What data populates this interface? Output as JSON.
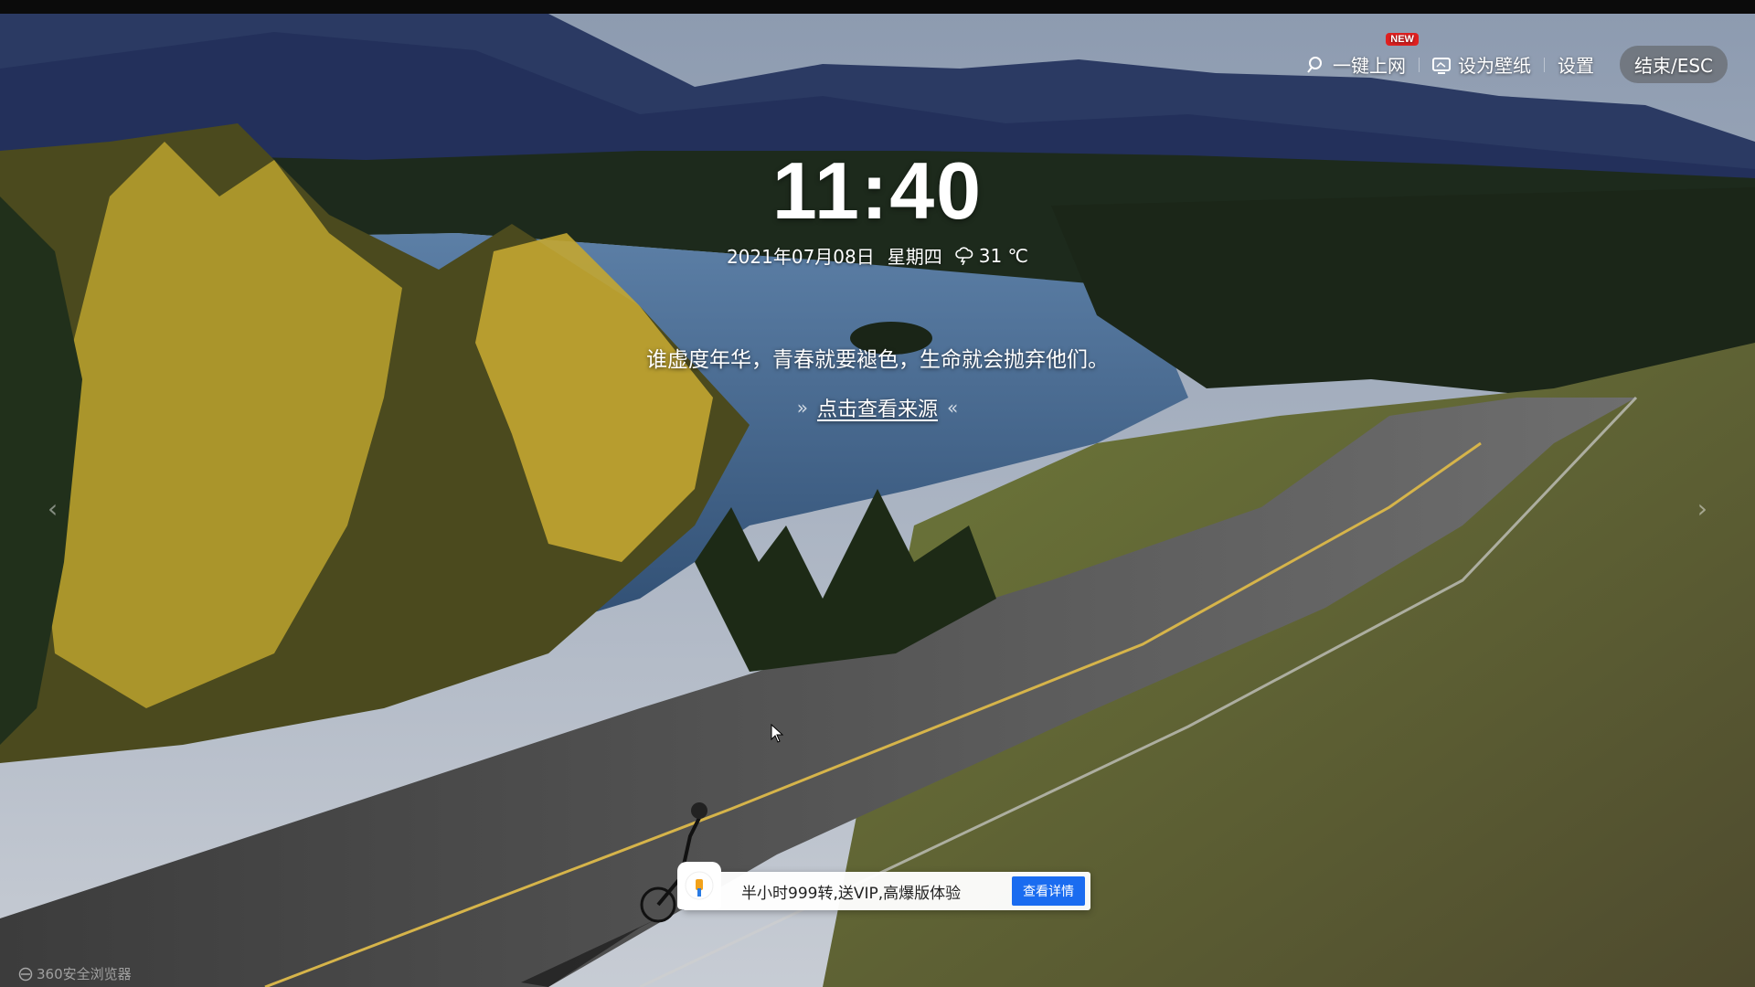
{
  "toolbar": {
    "one_click_label": "一键上网",
    "new_badge": "NEW",
    "wallpaper_label": "设为壁纸",
    "settings_label": "设置",
    "exit_label": "结束/ESC"
  },
  "clock": {
    "time": "11:40",
    "date": "2021年07月08日",
    "weekday": "星期四",
    "temperature": "31 ℃"
  },
  "quote": {
    "text": "谁虚度年华，青春就要褪色，生命就会抛弃他们。",
    "source_link": "点击查看来源"
  },
  "ad": {
    "text": "半小时999转,送VIP,高爆版体验",
    "button": "查看详情"
  },
  "brand": {
    "text": "360安全浏览器"
  },
  "colors": {
    "accent_blue": "#1a6cf0",
    "badge_red": "#e02020"
  }
}
